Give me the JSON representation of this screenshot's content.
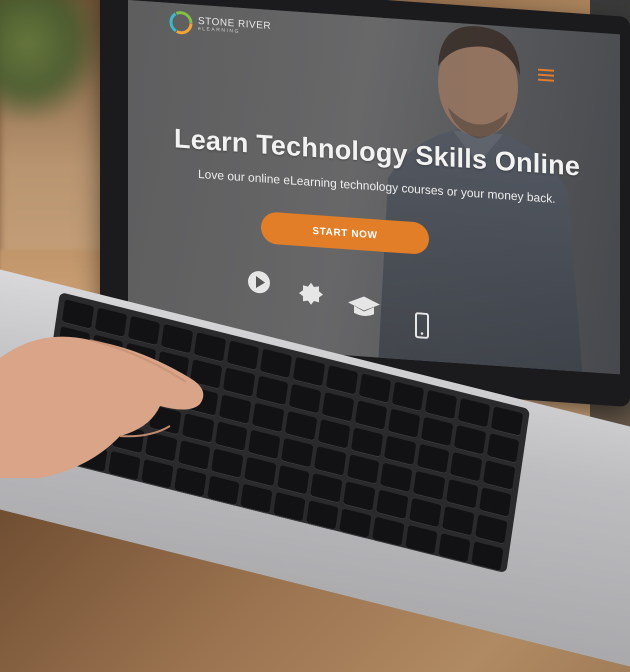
{
  "site": {
    "logo_name": "STONE RIVER",
    "logo_sub": "eLEARNING",
    "headline": "Learn Technology Skills Online",
    "subline": "Love our online eLearning technology courses or your money back.",
    "cta_label": "START NOW",
    "accent_color": "#e17e27",
    "menu_icon": "hamburger-icon",
    "feature_icons": [
      "play-icon",
      "badge-icon",
      "graduation-cap-icon",
      "phone-icon"
    ]
  }
}
